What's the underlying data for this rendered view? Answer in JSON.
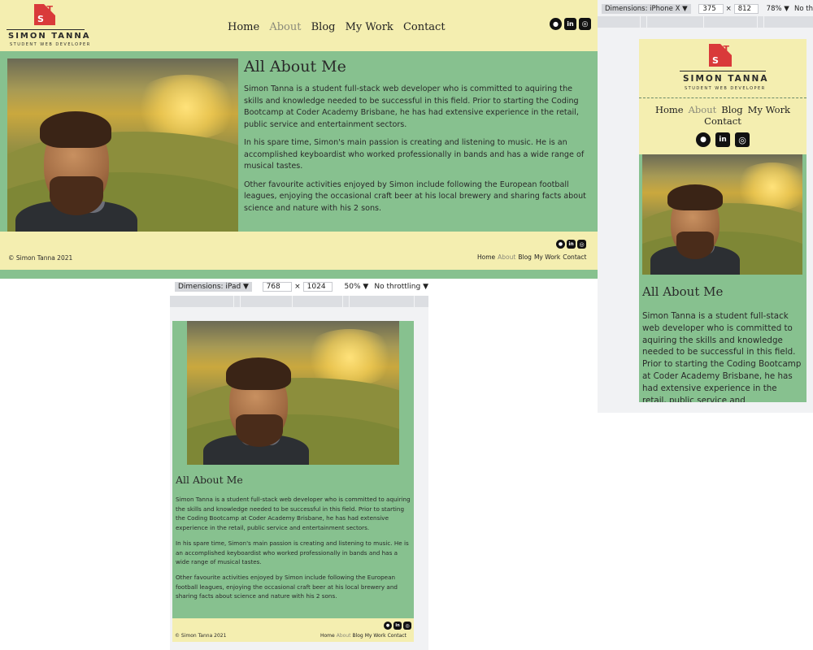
{
  "site": {
    "logo": {
      "letters": [
        "S",
        "T"
      ],
      "name": "SIMON TANNA",
      "subtitle": "STUDENT WEB DEVELOPER"
    },
    "nav": [
      {
        "label": "Home",
        "active": false
      },
      {
        "label": "About",
        "active": true
      },
      {
        "label": "Blog",
        "active": false
      },
      {
        "label": "My Work",
        "active": false
      },
      {
        "label": "Contact",
        "active": false
      }
    ],
    "social_icons": [
      "github-icon",
      "linkedin-icon",
      "instagram-icon"
    ],
    "content": {
      "heading": "All About Me",
      "paragraphs": [
        "Simon Tanna is a student full-stack web developer who is committed to aquiring the skills and knowledge needed to be successful in this field. Prior to starting the Coding Bootcamp at Coder Academy Brisbane, he has had extensive experience in the retail, public service and entertainment sectors.",
        "In his spare time, Simon's main passion is creating and listening to music. He is an accomplished keyboardist who worked professionally in bands and has a wide range of musical tastes.",
        "Other favourite activities enjoyed by Simon include following the European football leagues, enjoying the occasional craft beer at his local brewery and sharing facts about science and nature with his 2 sons."
      ],
      "mobile_paragraph_partial": "Simon Tanna is a student full-stack web developer who is committed to aquiring the skills and knowledge needed to be successful in this field. Prior to starting the Coding Bootcamp at Coder Academy Brisbane, he has had extensive experience in the retail, public service and entertainment"
    },
    "footer": {
      "copyright": "© Simon Tanna 2021"
    }
  },
  "devtools": {
    "ipad": {
      "device_label": "Dimensions: iPad ▼",
      "width": "768",
      "times": "×",
      "height": "1024",
      "zoom": "50% ▼",
      "throttle": "No throttling ▼"
    },
    "iphone": {
      "device_label": "Dimensions: iPhone X ▼",
      "width": "375",
      "times": "×",
      "height": "812",
      "zoom": "78% ▼",
      "throttle": "No th"
    }
  },
  "colors": {
    "cream": "#f4eeb0",
    "green": "#87c18f",
    "logo_red": "#d93a3a",
    "active_nav": "#8a8a7a"
  }
}
